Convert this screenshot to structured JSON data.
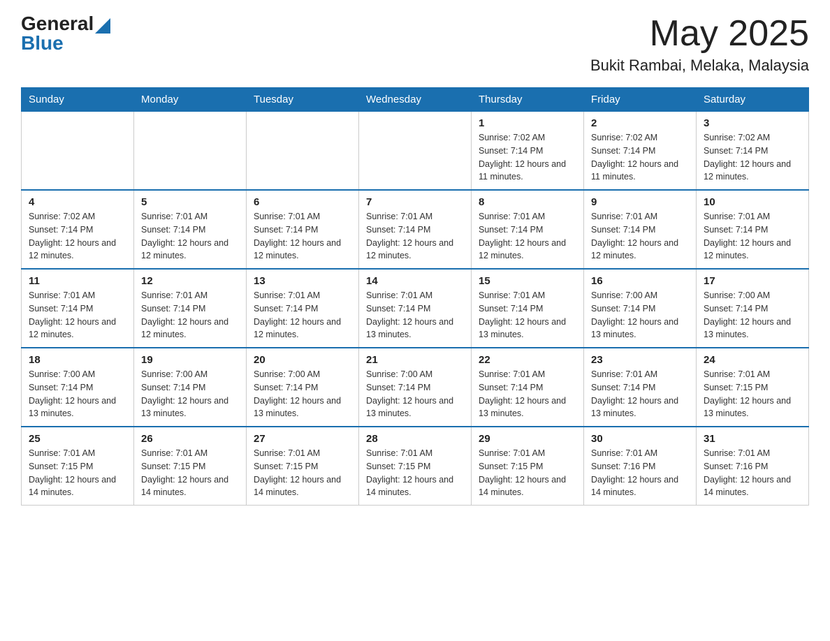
{
  "header": {
    "logo_general": "General",
    "logo_blue": "Blue",
    "month": "May 2025",
    "location": "Bukit Rambai, Melaka, Malaysia"
  },
  "weekdays": [
    "Sunday",
    "Monday",
    "Tuesday",
    "Wednesday",
    "Thursday",
    "Friday",
    "Saturday"
  ],
  "weeks": [
    [
      {
        "day": "",
        "sunrise": "",
        "sunset": "",
        "daylight": ""
      },
      {
        "day": "",
        "sunrise": "",
        "sunset": "",
        "daylight": ""
      },
      {
        "day": "",
        "sunrise": "",
        "sunset": "",
        "daylight": ""
      },
      {
        "day": "",
        "sunrise": "",
        "sunset": "",
        "daylight": ""
      },
      {
        "day": "1",
        "sunrise": "Sunrise: 7:02 AM",
        "sunset": "Sunset: 7:14 PM",
        "daylight": "Daylight: 12 hours and 11 minutes."
      },
      {
        "day": "2",
        "sunrise": "Sunrise: 7:02 AM",
        "sunset": "Sunset: 7:14 PM",
        "daylight": "Daylight: 12 hours and 11 minutes."
      },
      {
        "day": "3",
        "sunrise": "Sunrise: 7:02 AM",
        "sunset": "Sunset: 7:14 PM",
        "daylight": "Daylight: 12 hours and 12 minutes."
      }
    ],
    [
      {
        "day": "4",
        "sunrise": "Sunrise: 7:02 AM",
        "sunset": "Sunset: 7:14 PM",
        "daylight": "Daylight: 12 hours and 12 minutes."
      },
      {
        "day": "5",
        "sunrise": "Sunrise: 7:01 AM",
        "sunset": "Sunset: 7:14 PM",
        "daylight": "Daylight: 12 hours and 12 minutes."
      },
      {
        "day": "6",
        "sunrise": "Sunrise: 7:01 AM",
        "sunset": "Sunset: 7:14 PM",
        "daylight": "Daylight: 12 hours and 12 minutes."
      },
      {
        "day": "7",
        "sunrise": "Sunrise: 7:01 AM",
        "sunset": "Sunset: 7:14 PM",
        "daylight": "Daylight: 12 hours and 12 minutes."
      },
      {
        "day": "8",
        "sunrise": "Sunrise: 7:01 AM",
        "sunset": "Sunset: 7:14 PM",
        "daylight": "Daylight: 12 hours and 12 minutes."
      },
      {
        "day": "9",
        "sunrise": "Sunrise: 7:01 AM",
        "sunset": "Sunset: 7:14 PM",
        "daylight": "Daylight: 12 hours and 12 minutes."
      },
      {
        "day": "10",
        "sunrise": "Sunrise: 7:01 AM",
        "sunset": "Sunset: 7:14 PM",
        "daylight": "Daylight: 12 hours and 12 minutes."
      }
    ],
    [
      {
        "day": "11",
        "sunrise": "Sunrise: 7:01 AM",
        "sunset": "Sunset: 7:14 PM",
        "daylight": "Daylight: 12 hours and 12 minutes."
      },
      {
        "day": "12",
        "sunrise": "Sunrise: 7:01 AM",
        "sunset": "Sunset: 7:14 PM",
        "daylight": "Daylight: 12 hours and 12 minutes."
      },
      {
        "day": "13",
        "sunrise": "Sunrise: 7:01 AM",
        "sunset": "Sunset: 7:14 PM",
        "daylight": "Daylight: 12 hours and 12 minutes."
      },
      {
        "day": "14",
        "sunrise": "Sunrise: 7:01 AM",
        "sunset": "Sunset: 7:14 PM",
        "daylight": "Daylight: 12 hours and 13 minutes."
      },
      {
        "day": "15",
        "sunrise": "Sunrise: 7:01 AM",
        "sunset": "Sunset: 7:14 PM",
        "daylight": "Daylight: 12 hours and 13 minutes."
      },
      {
        "day": "16",
        "sunrise": "Sunrise: 7:00 AM",
        "sunset": "Sunset: 7:14 PM",
        "daylight": "Daylight: 12 hours and 13 minutes."
      },
      {
        "day": "17",
        "sunrise": "Sunrise: 7:00 AM",
        "sunset": "Sunset: 7:14 PM",
        "daylight": "Daylight: 12 hours and 13 minutes."
      }
    ],
    [
      {
        "day": "18",
        "sunrise": "Sunrise: 7:00 AM",
        "sunset": "Sunset: 7:14 PM",
        "daylight": "Daylight: 12 hours and 13 minutes."
      },
      {
        "day": "19",
        "sunrise": "Sunrise: 7:00 AM",
        "sunset": "Sunset: 7:14 PM",
        "daylight": "Daylight: 12 hours and 13 minutes."
      },
      {
        "day": "20",
        "sunrise": "Sunrise: 7:00 AM",
        "sunset": "Sunset: 7:14 PM",
        "daylight": "Daylight: 12 hours and 13 minutes."
      },
      {
        "day": "21",
        "sunrise": "Sunrise: 7:00 AM",
        "sunset": "Sunset: 7:14 PM",
        "daylight": "Daylight: 12 hours and 13 minutes."
      },
      {
        "day": "22",
        "sunrise": "Sunrise: 7:01 AM",
        "sunset": "Sunset: 7:14 PM",
        "daylight": "Daylight: 12 hours and 13 minutes."
      },
      {
        "day": "23",
        "sunrise": "Sunrise: 7:01 AM",
        "sunset": "Sunset: 7:14 PM",
        "daylight": "Daylight: 12 hours and 13 minutes."
      },
      {
        "day": "24",
        "sunrise": "Sunrise: 7:01 AM",
        "sunset": "Sunset: 7:15 PM",
        "daylight": "Daylight: 12 hours and 13 minutes."
      }
    ],
    [
      {
        "day": "25",
        "sunrise": "Sunrise: 7:01 AM",
        "sunset": "Sunset: 7:15 PM",
        "daylight": "Daylight: 12 hours and 14 minutes."
      },
      {
        "day": "26",
        "sunrise": "Sunrise: 7:01 AM",
        "sunset": "Sunset: 7:15 PM",
        "daylight": "Daylight: 12 hours and 14 minutes."
      },
      {
        "day": "27",
        "sunrise": "Sunrise: 7:01 AM",
        "sunset": "Sunset: 7:15 PM",
        "daylight": "Daylight: 12 hours and 14 minutes."
      },
      {
        "day": "28",
        "sunrise": "Sunrise: 7:01 AM",
        "sunset": "Sunset: 7:15 PM",
        "daylight": "Daylight: 12 hours and 14 minutes."
      },
      {
        "day": "29",
        "sunrise": "Sunrise: 7:01 AM",
        "sunset": "Sunset: 7:15 PM",
        "daylight": "Daylight: 12 hours and 14 minutes."
      },
      {
        "day": "30",
        "sunrise": "Sunrise: 7:01 AM",
        "sunset": "Sunset: 7:16 PM",
        "daylight": "Daylight: 12 hours and 14 minutes."
      },
      {
        "day": "31",
        "sunrise": "Sunrise: 7:01 AM",
        "sunset": "Sunset: 7:16 PM",
        "daylight": "Daylight: 12 hours and 14 minutes."
      }
    ]
  ]
}
